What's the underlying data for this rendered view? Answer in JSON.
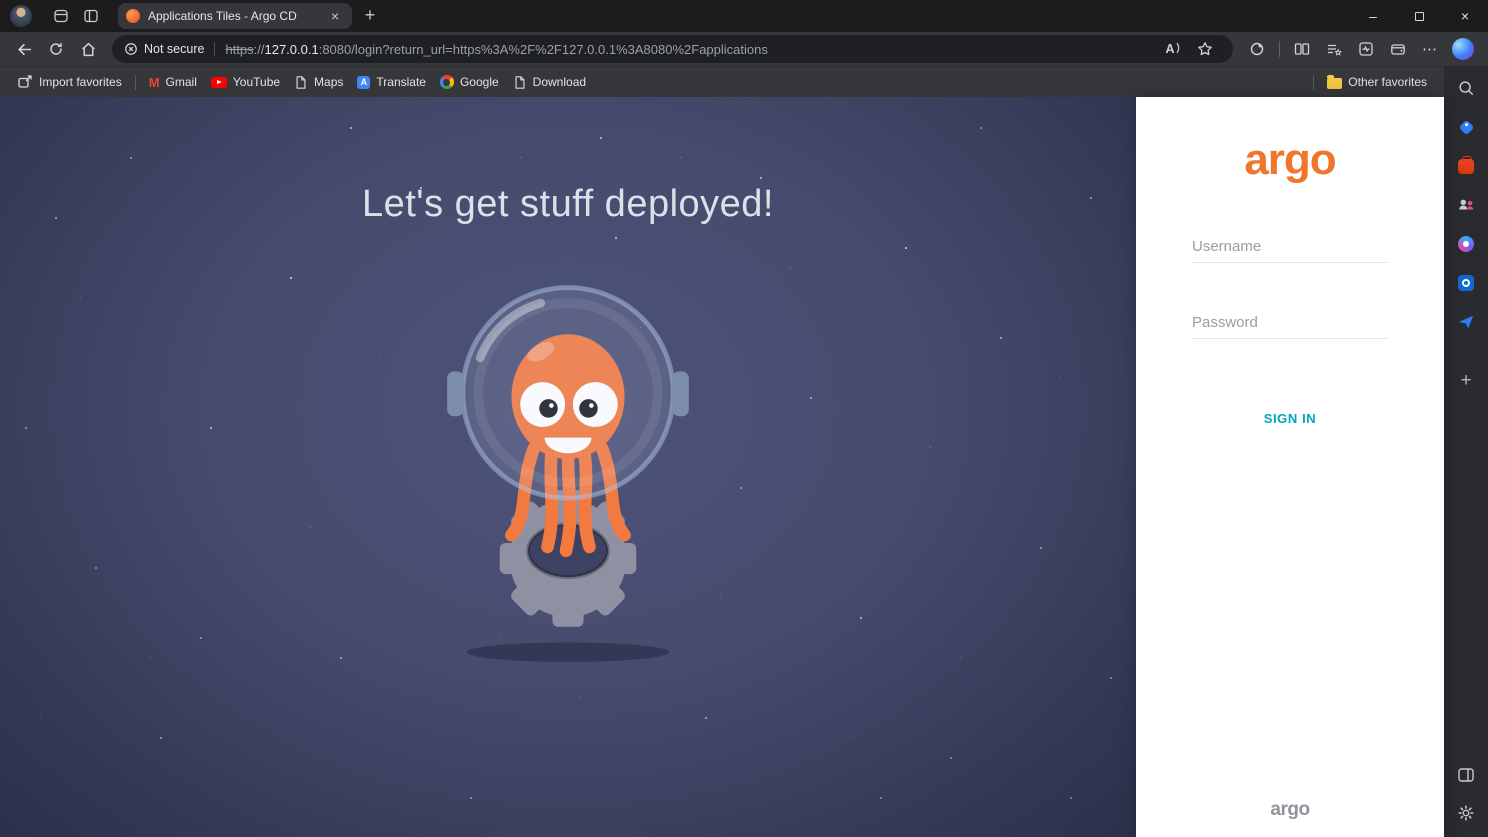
{
  "window": {
    "tab_title": "Applications Tiles - Argo CD",
    "glyphs": {
      "minimize": "–",
      "close": "×",
      "tab_close": "×",
      "new_tab": "+"
    }
  },
  "navbar": {
    "security_label": "Not secure",
    "url": {
      "scheme": "https",
      "separator": "://",
      "host": "127.0.0.1",
      "rest": ":8080/login?return_url=https%3A%2F%2F127.0.0.1%3A8080%2Fapplications"
    },
    "read_aloud_glyph": "A",
    "more_glyph": "⋯"
  },
  "favorites_bar": {
    "import_label": "Import favorites",
    "items": [
      {
        "label": "Gmail",
        "icon_glyph": "M"
      },
      {
        "label": "YouTube"
      },
      {
        "label": "Maps"
      },
      {
        "label": "Translate",
        "icon_glyph": "A"
      },
      {
        "label": "Google"
      },
      {
        "label": "Download"
      }
    ],
    "other_label": "Other favorites"
  },
  "sidebar": {
    "add_glyph": "+"
  },
  "login": {
    "headline": "Let's get stuff deployed!",
    "logo_text": "argo",
    "username_placeholder": "Username",
    "password_placeholder": "Password",
    "sign_in_label": "SIGN IN",
    "footer_logo_text": "argo",
    "colors": {
      "logo_orange": "#F0762C",
      "sign_in_teal": "#00A7B7",
      "background_blue": "#434869",
      "mascot_orange": "#F4793F"
    }
  }
}
